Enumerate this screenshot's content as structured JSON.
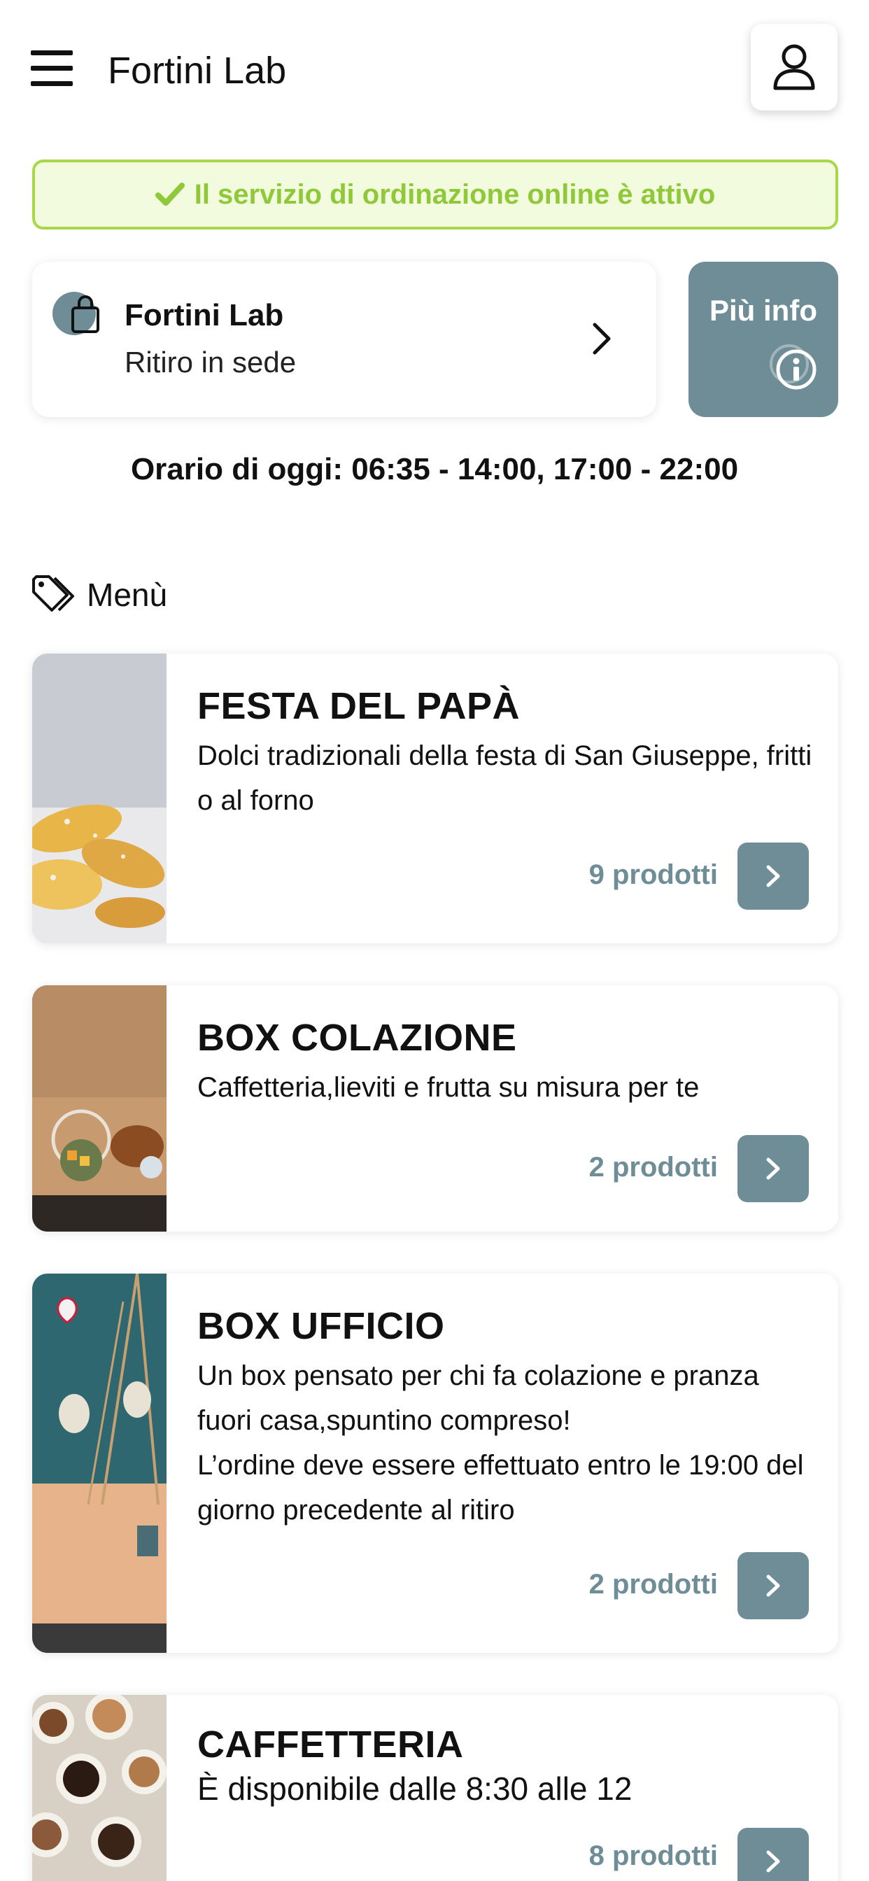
{
  "header": {
    "title": "Fortini Lab",
    "menu_icon": "hamburger-menu-icon",
    "user_icon": "user-icon"
  },
  "status": {
    "text": "Il servizio di ordinazione online è attivo",
    "icon": "check-icon",
    "color": "#8fc93a"
  },
  "store": {
    "name": "Fortini Lab",
    "mode": "Ritiro in sede",
    "icon": "shopping-bag-icon"
  },
  "info_button": {
    "label": "Più info",
    "icon": "info-icon"
  },
  "hours": "Orario di oggi: 06:35 - 14:00, 17:00 - 22:00",
  "menu": {
    "heading": "Menù",
    "icon": "tag-icon",
    "categories": [
      {
        "title": "FESTA DEL PAPÀ",
        "description": "Dolci tradizionali della festa di San Giuseppe, fritti o al forno",
        "count": "9 prodotti"
      },
      {
        "title": "BOX COLAZIONE",
        "description": "Caffetteria,lieviti e frutta su misura per te",
        "count": "2 prodotti"
      },
      {
        "title": "BOX UFFICIO",
        "description": "Un box pensato per chi fa colazione e pranza fuori casa,spuntino compreso!\nL’ordine deve essere effettuato entro le 19:00 del giorno precedente al ritiro",
        "count": "2 prodotti"
      },
      {
        "title": "CAFFETTERIA",
        "description": "È disponibile dalle 8:30 alle 12",
        "count": "8 prodotti"
      }
    ]
  },
  "colors": {
    "accent": "#6e8d96",
    "success": "#a8d84a"
  }
}
